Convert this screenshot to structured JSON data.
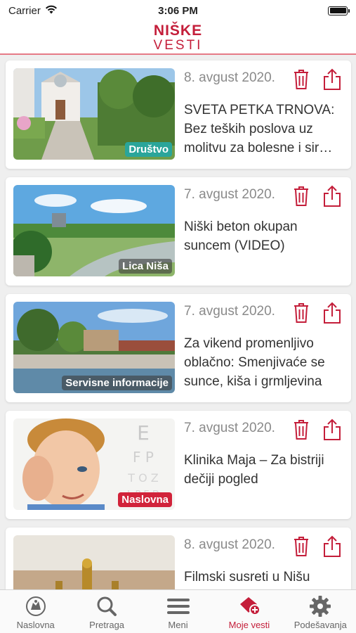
{
  "status_bar": {
    "carrier": "Carrier",
    "time": "3:06 PM"
  },
  "header": {
    "logo_top": "NIŠKE",
    "logo_bottom": "VESTI"
  },
  "articles": [
    {
      "date": "8. avgust 2020.",
      "title": "SVETA PETKA TRNOVA: Bez teških poslova uz molitvu za bolesne i sir…",
      "category": "Društvo"
    },
    {
      "date": "7. avgust 2020.",
      "title": "Niški beton okupan suncem (VIDEO)",
      "category": "Lica Niša"
    },
    {
      "date": "7. avgust 2020.",
      "title": "Za vikend promenljivo oblačno: Smenjivaće se sunce, kiša i grmljevina",
      "category": "Servisne informacije"
    },
    {
      "date": "7. avgust 2020.",
      "title": "Klinika Maja – Za bistriji dečiji pogled",
      "category": "Naslovna"
    },
    {
      "date": "8. avgust 2020.",
      "title": "Filmski susreti u Nišu",
      "category": ""
    }
  ],
  "tab_bar": {
    "items": [
      {
        "label": "Naslovna",
        "icon": "home-emblem-icon"
      },
      {
        "label": "Pretraga",
        "icon": "search-icon"
      },
      {
        "label": "Meni",
        "icon": "menu-icon"
      },
      {
        "label": "Moje vesti",
        "icon": "saved-news-icon",
        "active": true
      },
      {
        "label": "Podešavanja",
        "icon": "gear-icon"
      }
    ]
  },
  "colors": {
    "brand": "#c41e3a",
    "teal_badge": "#2aa59a",
    "red_badge": "#d1233a",
    "date_gray": "#8a8a8a"
  }
}
